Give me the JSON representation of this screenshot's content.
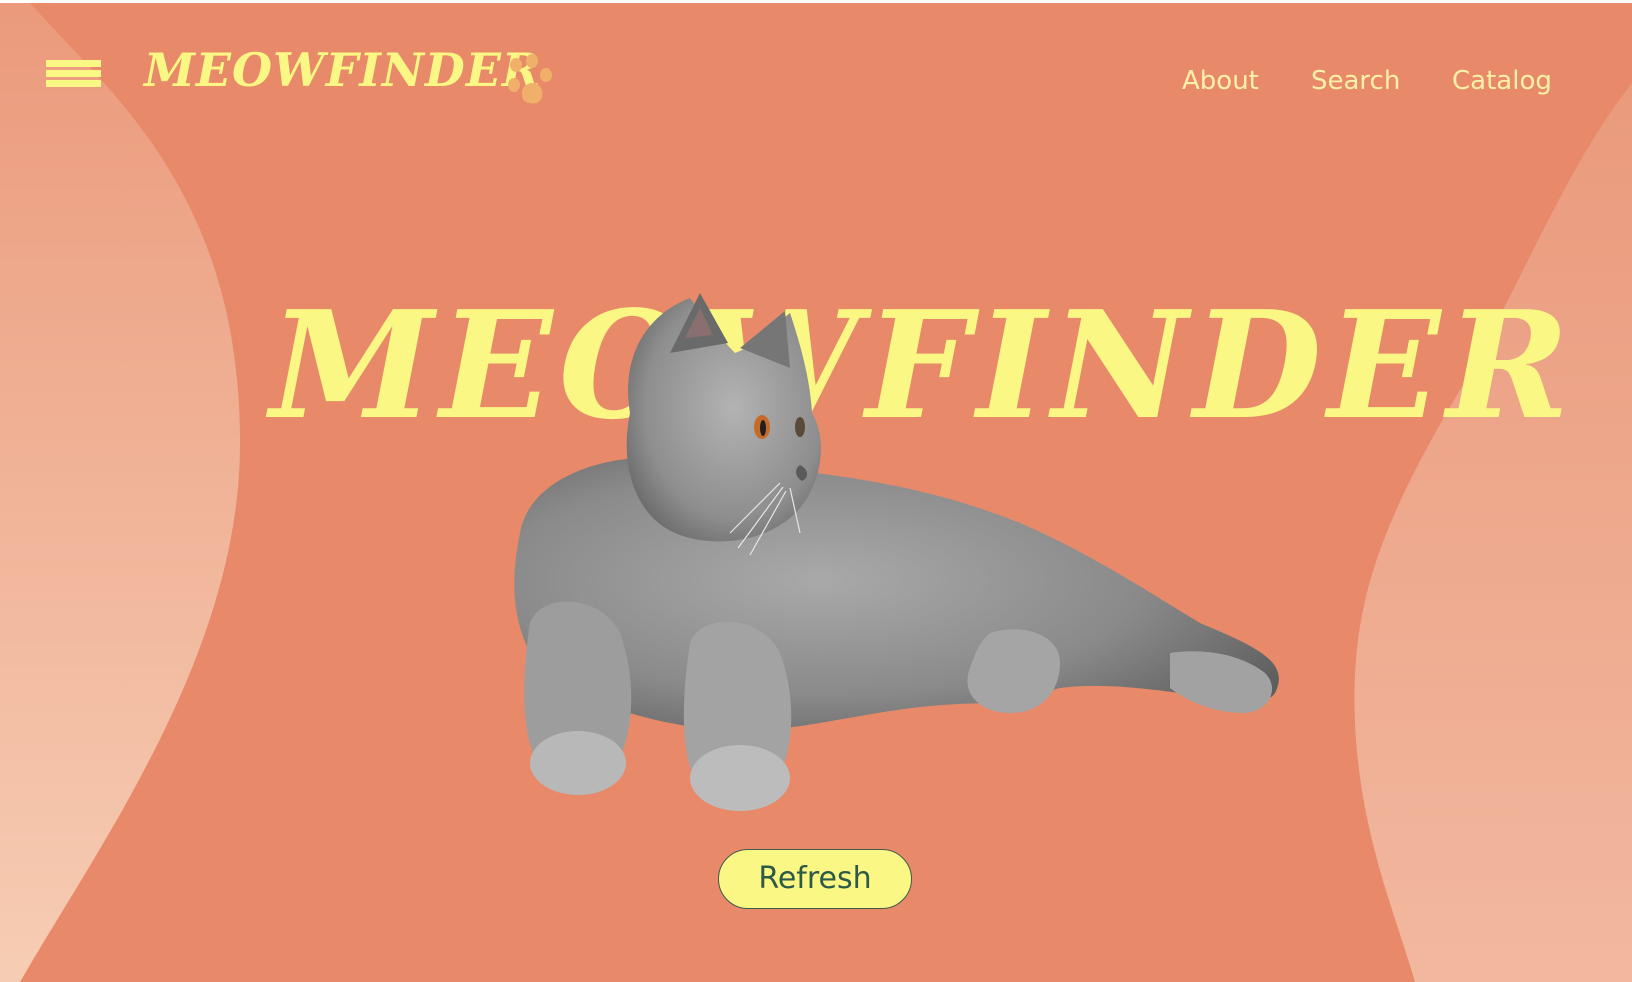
{
  "brand": {
    "logo_text": "MEOWFINDER",
    "hero_title": "MEOWFINDER"
  },
  "icons": {
    "menu": "hamburger-menu-icon",
    "paw": "paw-print-icon"
  },
  "nav": {
    "items": [
      {
        "label": "About"
      },
      {
        "label": "Search"
      },
      {
        "label": "Catalog"
      }
    ]
  },
  "hero": {
    "image": "gray-british-shorthair-cat",
    "refresh_label": "Refresh"
  },
  "colors": {
    "background": "#e88a69",
    "accent_yellow": "#fbf784",
    "nav_text": "#fbf0a8",
    "paw": "#f1b06a",
    "button_text": "#2e5848"
  }
}
